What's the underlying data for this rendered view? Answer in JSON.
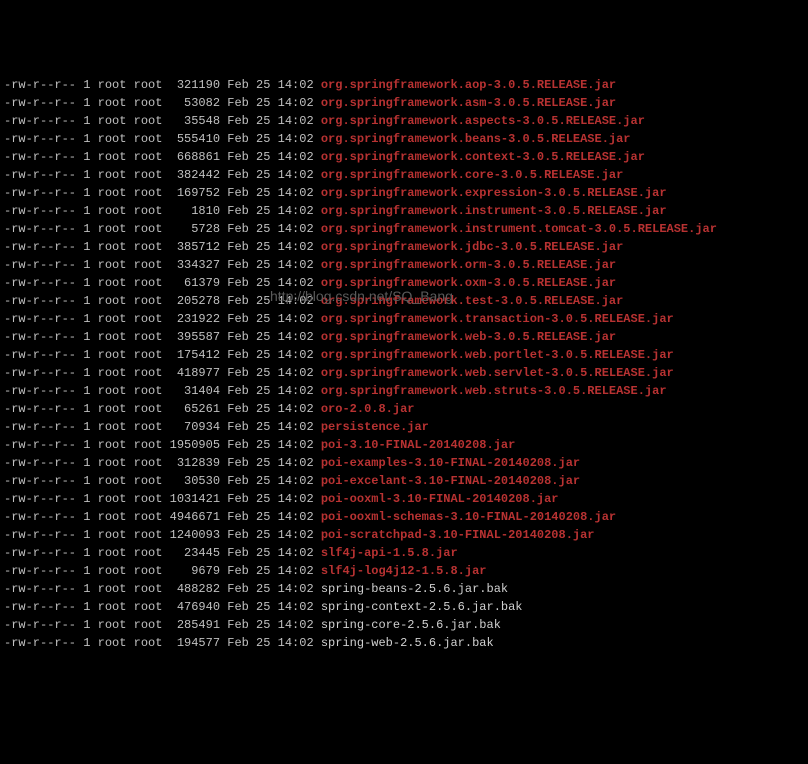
{
  "watermark": "http://blog.csdn.net/SQ_Bang",
  "files": [
    {
      "perm": "-rw-r--r--",
      "links": "1",
      "owner": "root",
      "group": "root",
      "size": "321190",
      "month": "Feb",
      "day": "25",
      "time": "14:02",
      "name": "org.springframework.aop-3.0.5.RELEASE.jar",
      "color": "red"
    },
    {
      "perm": "-rw-r--r--",
      "links": "1",
      "owner": "root",
      "group": "root",
      "size": "53082",
      "month": "Feb",
      "day": "25",
      "time": "14:02",
      "name": "org.springframework.asm-3.0.5.RELEASE.jar",
      "color": "red"
    },
    {
      "perm": "-rw-r--r--",
      "links": "1",
      "owner": "root",
      "group": "root",
      "size": "35548",
      "month": "Feb",
      "day": "25",
      "time": "14:02",
      "name": "org.springframework.aspects-3.0.5.RELEASE.jar",
      "color": "red"
    },
    {
      "perm": "-rw-r--r--",
      "links": "1",
      "owner": "root",
      "group": "root",
      "size": "555410",
      "month": "Feb",
      "day": "25",
      "time": "14:02",
      "name": "org.springframework.beans-3.0.5.RELEASE.jar",
      "color": "red"
    },
    {
      "perm": "-rw-r--r--",
      "links": "1",
      "owner": "root",
      "group": "root",
      "size": "668861",
      "month": "Feb",
      "day": "25",
      "time": "14:02",
      "name": "org.springframework.context-3.0.5.RELEASE.jar",
      "color": "red"
    },
    {
      "perm": "-rw-r--r--",
      "links": "1",
      "owner": "root",
      "group": "root",
      "size": "382442",
      "month": "Feb",
      "day": "25",
      "time": "14:02",
      "name": "org.springframework.core-3.0.5.RELEASE.jar",
      "color": "red"
    },
    {
      "perm": "-rw-r--r--",
      "links": "1",
      "owner": "root",
      "group": "root",
      "size": "169752",
      "month": "Feb",
      "day": "25",
      "time": "14:02",
      "name": "org.springframework.expression-3.0.5.RELEASE.jar",
      "color": "red"
    },
    {
      "perm": "-rw-r--r--",
      "links": "1",
      "owner": "root",
      "group": "root",
      "size": "1810",
      "month": "Feb",
      "day": "25",
      "time": "14:02",
      "name": "org.springframework.instrument-3.0.5.RELEASE.jar",
      "color": "red"
    },
    {
      "perm": "-rw-r--r--",
      "links": "1",
      "owner": "root",
      "group": "root",
      "size": "5728",
      "month": "Feb",
      "day": "25",
      "time": "14:02",
      "name": "org.springframework.instrument.tomcat-3.0.5.RELEASE.jar",
      "color": "red"
    },
    {
      "perm": "-rw-r--r--",
      "links": "1",
      "owner": "root",
      "group": "root",
      "size": "385712",
      "month": "Feb",
      "day": "25",
      "time": "14:02",
      "name": "org.springframework.jdbc-3.0.5.RELEASE.jar",
      "color": "red"
    },
    {
      "perm": "-rw-r--r--",
      "links": "1",
      "owner": "root",
      "group": "root",
      "size": "334327",
      "month": "Feb",
      "day": "25",
      "time": "14:02",
      "name": "org.springframework.orm-3.0.5.RELEASE.jar",
      "color": "red"
    },
    {
      "perm": "-rw-r--r--",
      "links": "1",
      "owner": "root",
      "group": "root",
      "size": "61379",
      "month": "Feb",
      "day": "25",
      "time": "14:02",
      "name": "org.springframework.oxm-3.0.5.RELEASE.jar",
      "color": "red"
    },
    {
      "perm": "-rw-r--r--",
      "links": "1",
      "owner": "root",
      "group": "root",
      "size": "205278",
      "month": "Feb",
      "day": "25",
      "time": "14:02",
      "name": "org.springframework.test-3.0.5.RELEASE.jar",
      "color": "red"
    },
    {
      "perm": "-rw-r--r--",
      "links": "1",
      "owner": "root",
      "group": "root",
      "size": "231922",
      "month": "Feb",
      "day": "25",
      "time": "14:02",
      "name": "org.springframework.transaction-3.0.5.RELEASE.jar",
      "color": "red"
    },
    {
      "perm": "-rw-r--r--",
      "links": "1",
      "owner": "root",
      "group": "root",
      "size": "395587",
      "month": "Feb",
      "day": "25",
      "time": "14:02",
      "name": "org.springframework.web-3.0.5.RELEASE.jar",
      "color": "red"
    },
    {
      "perm": "-rw-r--r--",
      "links": "1",
      "owner": "root",
      "group": "root",
      "size": "175412",
      "month": "Feb",
      "day": "25",
      "time": "14:02",
      "name": "org.springframework.web.portlet-3.0.5.RELEASE.jar",
      "color": "red"
    },
    {
      "perm": "-rw-r--r--",
      "links": "1",
      "owner": "root",
      "group": "root",
      "size": "418977",
      "month": "Feb",
      "day": "25",
      "time": "14:02",
      "name": "org.springframework.web.servlet-3.0.5.RELEASE.jar",
      "color": "red"
    },
    {
      "perm": "-rw-r--r--",
      "links": "1",
      "owner": "root",
      "group": "root",
      "size": "31404",
      "month": "Feb",
      "day": "25",
      "time": "14:02",
      "name": "org.springframework.web.struts-3.0.5.RELEASE.jar",
      "color": "red"
    },
    {
      "perm": "-rw-r--r--",
      "links": "1",
      "owner": "root",
      "group": "root",
      "size": "65261",
      "month": "Feb",
      "day": "25",
      "time": "14:02",
      "name": "oro-2.0.8.jar",
      "color": "red"
    },
    {
      "perm": "-rw-r--r--",
      "links": "1",
      "owner": "root",
      "group": "root",
      "size": "70934",
      "month": "Feb",
      "day": "25",
      "time": "14:02",
      "name": "persistence.jar",
      "color": "red"
    },
    {
      "perm": "-rw-r--r--",
      "links": "1",
      "owner": "root",
      "group": "root",
      "size": "1950905",
      "month": "Feb",
      "day": "25",
      "time": "14:02",
      "name": "poi-3.10-FINAL-20140208.jar",
      "color": "red"
    },
    {
      "perm": "-rw-r--r--",
      "links": "1",
      "owner": "root",
      "group": "root",
      "size": "312839",
      "month": "Feb",
      "day": "25",
      "time": "14:02",
      "name": "poi-examples-3.10-FINAL-20140208.jar",
      "color": "red"
    },
    {
      "perm": "-rw-r--r--",
      "links": "1",
      "owner": "root",
      "group": "root",
      "size": "30530",
      "month": "Feb",
      "day": "25",
      "time": "14:02",
      "name": "poi-excelant-3.10-FINAL-20140208.jar",
      "color": "red"
    },
    {
      "perm": "-rw-r--r--",
      "links": "1",
      "owner": "root",
      "group": "root",
      "size": "1031421",
      "month": "Feb",
      "day": "25",
      "time": "14:02",
      "name": "poi-ooxml-3.10-FINAL-20140208.jar",
      "color": "red"
    },
    {
      "perm": "-rw-r--r--",
      "links": "1",
      "owner": "root",
      "group": "root",
      "size": "4946671",
      "month": "Feb",
      "day": "25",
      "time": "14:02",
      "name": "poi-ooxml-schemas-3.10-FINAL-20140208.jar",
      "color": "red"
    },
    {
      "perm": "-rw-r--r--",
      "links": "1",
      "owner": "root",
      "group": "root",
      "size": "1240093",
      "month": "Feb",
      "day": "25",
      "time": "14:02",
      "name": "poi-scratchpad-3.10-FINAL-20140208.jar",
      "color": "red"
    },
    {
      "perm": "-rw-r--r--",
      "links": "1",
      "owner": "root",
      "group": "root",
      "size": "23445",
      "month": "Feb",
      "day": "25",
      "time": "14:02",
      "name": "slf4j-api-1.5.8.jar",
      "color": "red"
    },
    {
      "perm": "-rw-r--r--",
      "links": "1",
      "owner": "root",
      "group": "root",
      "size": "9679",
      "month": "Feb",
      "day": "25",
      "time": "14:02",
      "name": "slf4j-log4j12-1.5.8.jar",
      "color": "red"
    },
    {
      "perm": "-rw-r--r--",
      "links": "1",
      "owner": "root",
      "group": "root",
      "size": "488282",
      "month": "Feb",
      "day": "25",
      "time": "14:02",
      "name": "spring-beans-2.5.6.jar.bak",
      "color": "white"
    },
    {
      "perm": "-rw-r--r--",
      "links": "1",
      "owner": "root",
      "group": "root",
      "size": "476940",
      "month": "Feb",
      "day": "25",
      "time": "14:02",
      "name": "spring-context-2.5.6.jar.bak",
      "color": "white"
    },
    {
      "perm": "-rw-r--r--",
      "links": "1",
      "owner": "root",
      "group": "root",
      "size": "285491",
      "month": "Feb",
      "day": "25",
      "time": "14:02",
      "name": "spring-core-2.5.6.jar.bak",
      "color": "white"
    },
    {
      "perm": "-rw-r--r--",
      "links": "1",
      "owner": "root",
      "group": "root",
      "size": "194577",
      "month": "Feb",
      "day": "25",
      "time": "14:02",
      "name": "spring-web-2.5.6.jar.bak",
      "color": "white"
    }
  ]
}
